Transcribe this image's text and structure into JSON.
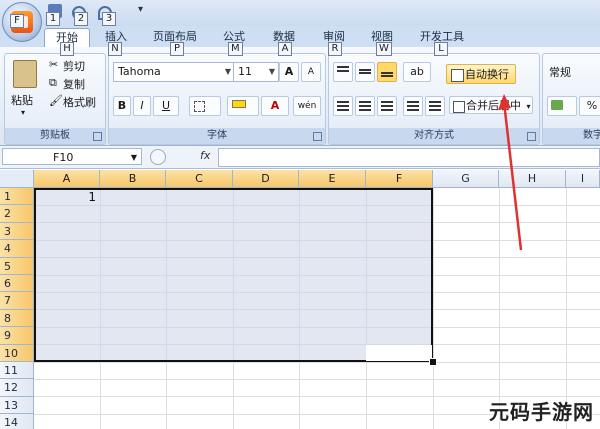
{
  "quick_access": {
    "keytips": [
      "1",
      "2",
      "3"
    ]
  },
  "tabs": [
    {
      "label": "开始",
      "keytip": "H"
    },
    {
      "label": "插入",
      "keytip": "N"
    },
    {
      "label": "页面布局",
      "keytip": "P"
    },
    {
      "label": "公式",
      "keytip": "M"
    },
    {
      "label": "数据",
      "keytip": "A"
    },
    {
      "label": "审阅",
      "keytip": "R"
    },
    {
      "label": "视图",
      "keytip": "W"
    },
    {
      "label": "开发工具",
      "keytip": "L"
    }
  ],
  "office_button_keytip": "F",
  "ribbon": {
    "clipboard": {
      "label": "剪贴板",
      "paste": "粘贴",
      "cut": "剪切",
      "copy": "复制",
      "format_painter": "格式刷"
    },
    "font": {
      "label": "字体",
      "font_name": "Tahoma",
      "font_size": "11",
      "grow": "A",
      "shrink": "A",
      "bold": "B",
      "italic": "I",
      "underline": "U",
      "font_color_letter": "A",
      "phonetic": "wén"
    },
    "alignment": {
      "label": "对齐方式",
      "wrap_text": "自动换行",
      "merge_center": "合并后居中"
    },
    "number": {
      "label": "数字",
      "format": "常规"
    }
  },
  "formula_bar": {
    "name_box": "F10",
    "fx": "fx",
    "formula": ""
  },
  "sheet": {
    "columns": [
      "A",
      "B",
      "C",
      "D",
      "E",
      "F",
      "G",
      "H",
      "I"
    ],
    "rows": [
      "1",
      "2",
      "3",
      "4",
      "5",
      "6",
      "7",
      "8",
      "9",
      "10",
      "11",
      "12",
      "13",
      "14"
    ],
    "cell_A1": "1",
    "selected_range": "A1:F10",
    "active_cell": "F10"
  },
  "watermark": "元码手游网",
  "colors": {
    "selection_fill": "#cad4e8",
    "header_highlight": "#f7c66a",
    "arrow": "#e03030",
    "wrap_button_highlight": "#ffd86a"
  }
}
